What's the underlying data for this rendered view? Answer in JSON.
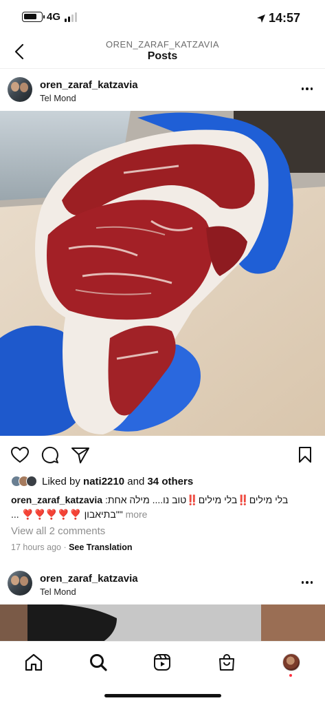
{
  "status_bar": {
    "network": "4G",
    "time": "14:57"
  },
  "header": {
    "account": "OREN_ZARAF_KATZAVIA",
    "title": "Posts"
  },
  "post1": {
    "username": "oren_zaraf_katzavia",
    "location": "Tel Mond",
    "likes_prefix": "Liked by ",
    "liked_by": "nati2210",
    "likes_and": " and ",
    "likes_others": "34 others",
    "caption_user": "oren_zaraf_katzavia",
    "caption_line1": "בלי מילים‼️בלי מילים‼️טוב נו.... מילה אחת:",
    "caption_line2": "\"\"בתיאבון ❣️❣️❣️❣️❣️ ...",
    "caption_more": "more",
    "view_comments": "View all 2 comments",
    "time_ago": "17 hours ago",
    "separator": " · ",
    "see_translation": "See Translation"
  },
  "post2": {
    "username": "oren_zaraf_katzavia",
    "location": "Tel Mond"
  },
  "icons": {
    "back": "chevron-left-icon",
    "more": "more-horizontal-icon",
    "like": "heart-icon",
    "comment": "comment-icon",
    "share": "send-icon",
    "save": "bookmark-icon",
    "home": "home-icon",
    "search": "search-icon",
    "reels": "reels-icon",
    "shop": "shopping-bag-icon"
  },
  "colors": {
    "muted_text": "#8e8e8e",
    "glove_blue": "#1f5fd6",
    "notification": "#ff3040"
  }
}
